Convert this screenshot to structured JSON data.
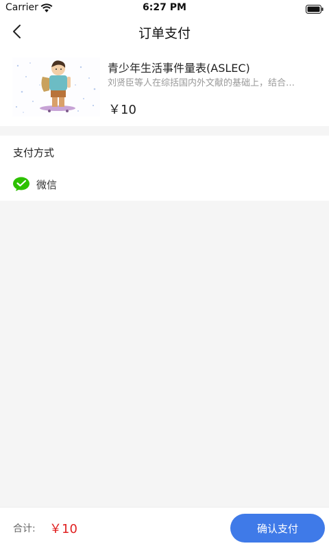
{
  "status_bar": {
    "carrier": "Carrier",
    "time": "6:27 PM",
    "wifi_icon": "wifi-icon",
    "battery_icon": "battery-icon"
  },
  "nav": {
    "title": "订单支付",
    "back_icon": "back-chevron-icon"
  },
  "product": {
    "title": "青少年生活事件量表(ASLEC)",
    "description": "刘贤臣等人在综括国内外文献的基础上，结合…",
    "price": "￥10",
    "image": "boy-skateboard-illustration"
  },
  "payment": {
    "heading": "支付方式",
    "option": {
      "label": "微信",
      "icon": "wechat-icon",
      "color": "#2dc100"
    }
  },
  "footer": {
    "total_label": "合计:",
    "total_amount": "￥10",
    "confirm_label": "确认支付"
  },
  "colors": {
    "accent": "#3f7ae8",
    "price_red": "#e02020",
    "wechat_green": "#2dc100",
    "background": "#f5f5f5"
  }
}
